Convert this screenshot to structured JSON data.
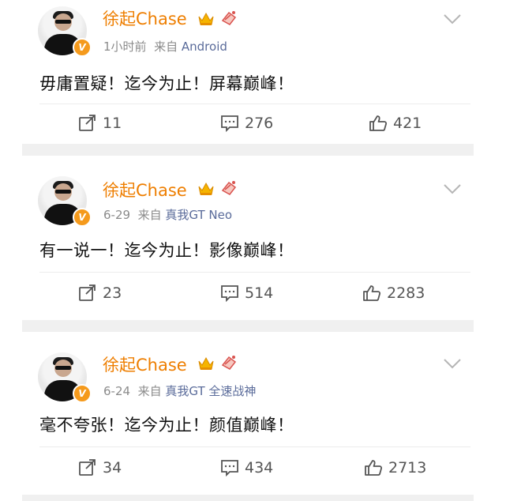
{
  "colors": {
    "name": "#ee7e00",
    "meta": "#8b8b8b",
    "source": "#5a6b9a",
    "separator": "#f0f0f0"
  },
  "posts": [
    {
      "user": "徐起Chase",
      "time": "1小时前",
      "from": "来自",
      "source": "Android",
      "content": "毋庸置疑！迄今为止！屏幕巅峰！",
      "reposts": "11",
      "comments": "276",
      "likes": "421"
    },
    {
      "user": "徐起Chase",
      "time": "6-29",
      "from": "来自",
      "source": "真我GT Neo",
      "content": "有一说一！迄今为止！影像巅峰！",
      "reposts": "23",
      "comments": "514",
      "likes": "2283"
    },
    {
      "user": "徐起Chase",
      "time": "6-24",
      "from": "来自",
      "source": "真我GT 全速战神",
      "content": "毫不夸张！迄今为止！颜值巅峰！",
      "reposts": "34",
      "comments": "434",
      "likes": "2713"
    }
  ],
  "icons": [
    "avatar-photo",
    "verified-v-badge",
    "crown-icon",
    "cheer-icon",
    "chevron-down-icon",
    "repost-icon",
    "comment-icon",
    "like-icon"
  ]
}
